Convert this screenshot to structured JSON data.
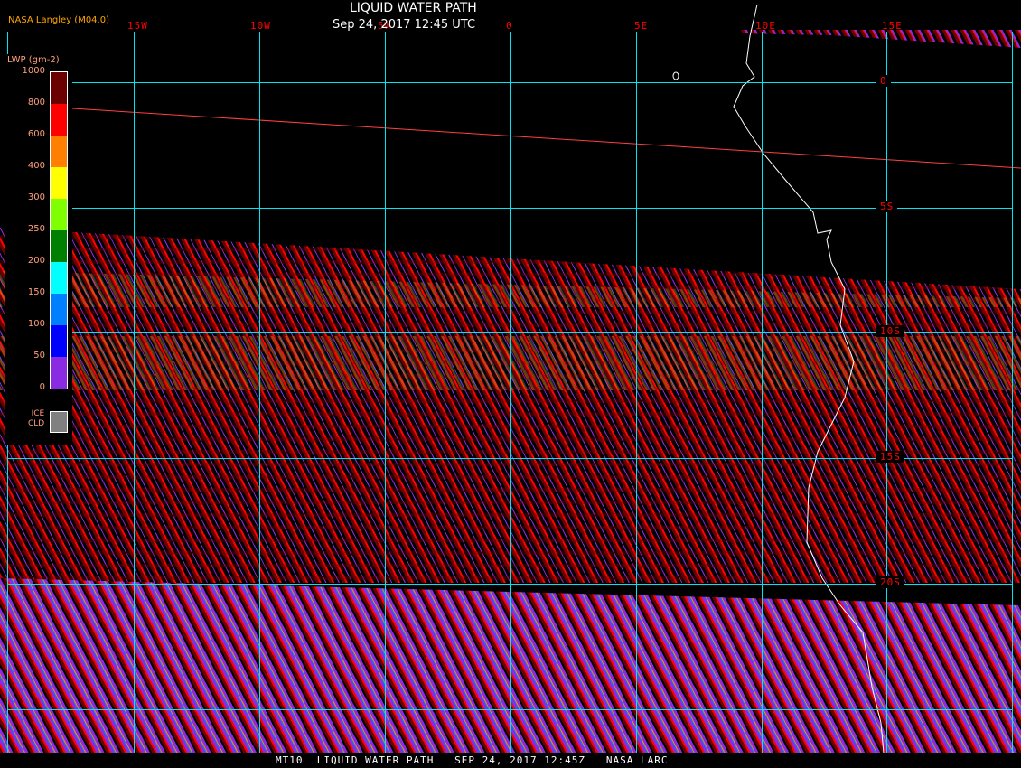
{
  "header": {
    "title": "LIQUID WATER PATH",
    "datetime": "Sep 24, 2017 12:45 UTC",
    "credit": "NASA Langley (M04.0)"
  },
  "grid": {
    "longitude_labels": [
      "15W",
      "10W",
      "5W",
      "0",
      "5E",
      "10E",
      "15E"
    ],
    "latitude_labels": [
      "0",
      "5S",
      "10S",
      "15S",
      "20S"
    ]
  },
  "legend": {
    "title": "LWP (gm-2)",
    "ticks": [
      "1000",
      "800",
      "600",
      "400",
      "300",
      "250",
      "200",
      "150",
      "100",
      "50",
      "0"
    ],
    "colors": [
      "#6b0000",
      "#ff0000",
      "#ff8000",
      "#ffff00",
      "#80ff00",
      "#008000",
      "#00ffff",
      "#0080ff",
      "#0000ff",
      "#8a2be2"
    ],
    "ice_label_1": "ICE",
    "ice_label_2": "CLD",
    "ice_color": "#808080"
  },
  "footer": {
    "caption": "MT10  LIQUID WATER PATH   SEP 24, 2017 12:45Z   NASA LARC"
  }
}
